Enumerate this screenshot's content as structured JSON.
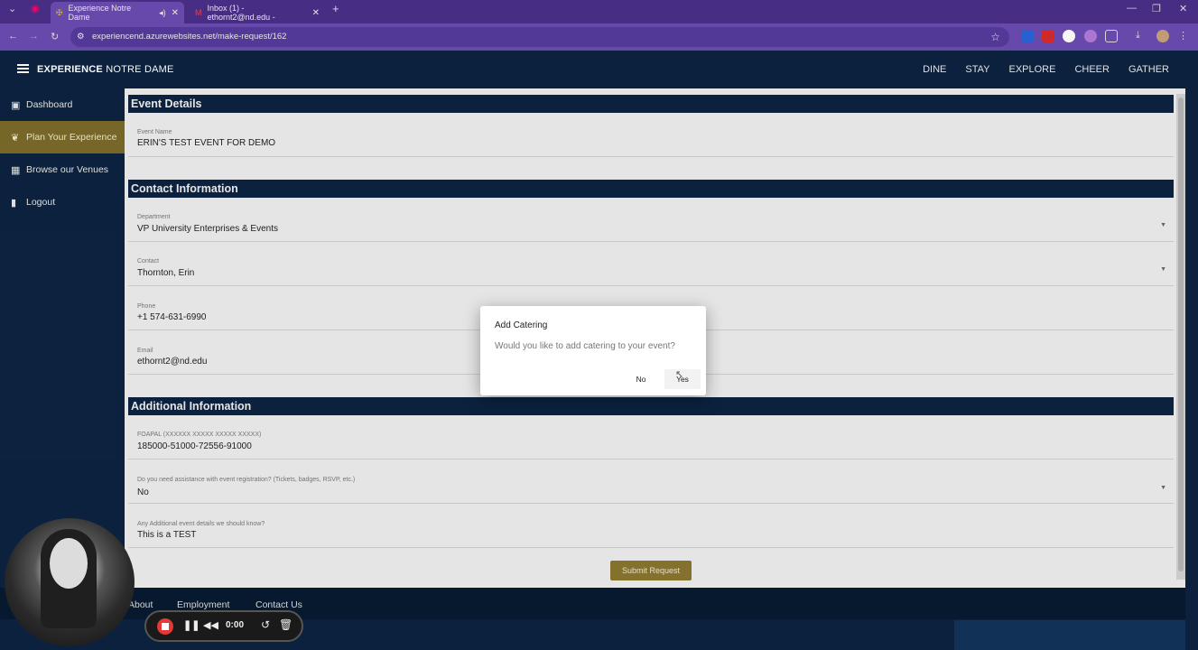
{
  "browser": {
    "tabs": [
      {
        "title": "Experience Notre Dame",
        "active": true
      },
      {
        "title": "Inbox (1) - ethornt2@nd.edu -",
        "active": false
      }
    ],
    "url": "experiencend.azurewebsites.net/make-request/162"
  },
  "header": {
    "brand_bold": "EXPERIENCE",
    "brand_rest": "NOTRE DAME",
    "nav": [
      "DINE",
      "STAY",
      "EXPLORE",
      "CHEER",
      "GATHER"
    ]
  },
  "sidebar": {
    "items": [
      {
        "label": "Dashboard",
        "icon": "calendar-icon"
      },
      {
        "label": "Plan Your Experience",
        "icon": "leaf-icon",
        "active": true
      },
      {
        "label": "Browse our Venues",
        "icon": "building-icon"
      },
      {
        "label": "Logout",
        "icon": "door-icon"
      }
    ]
  },
  "form": {
    "event_details": {
      "heading": "Event Details",
      "event_name_label": "Event Name",
      "event_name_value": "ERIN'S TEST EVENT FOR DEMO"
    },
    "contact": {
      "heading": "Contact Information",
      "department_label": "Department",
      "department_value": "VP University Enterprises & Events",
      "contact_label": "Contact",
      "contact_value": "Thornton, Erin",
      "phone_label": "Phone",
      "phone_value": "+1 574-631-6990",
      "email_label": "Email",
      "email_value": "ethornt2@nd.edu"
    },
    "additional": {
      "heading": "Additional Information",
      "foapal_label": "FOAPAL (XXXXXX XXXXX XXXXX XXXXX)",
      "foapal_value": "185000-51000-72556-91000",
      "assist_label": "Do you need assistance with event registration? (Tickets, badges, RSVP, etc.)",
      "assist_value": "No",
      "details_label": "Any Additional event details we should know?",
      "details_value": "This is a TEST"
    },
    "submit_label": "Submit Request"
  },
  "footer": {
    "links": [
      "About",
      "Employment",
      "Contact Us"
    ]
  },
  "dialog": {
    "title": "Add Catering",
    "message": "Would you like to add catering to your event?",
    "no_label": "No",
    "yes_label": "Yes"
  },
  "recorder": {
    "time": "0:00"
  }
}
